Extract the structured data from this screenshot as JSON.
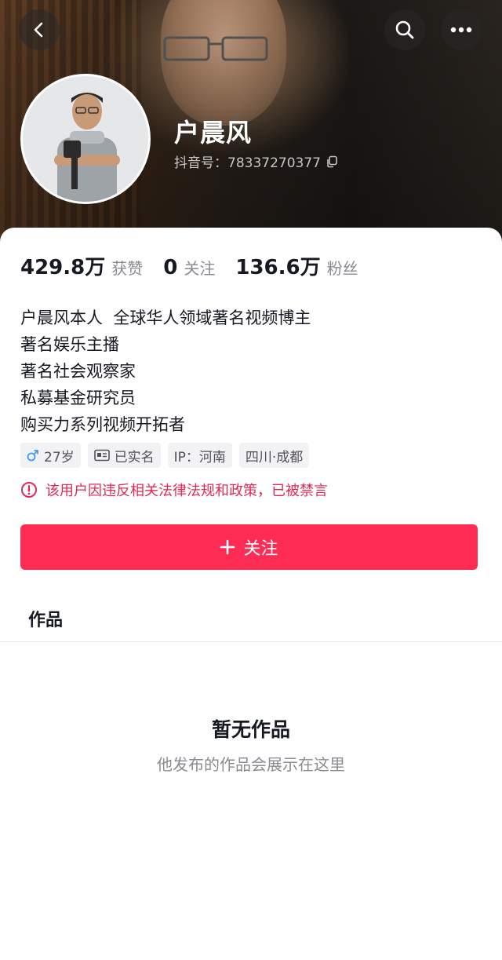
{
  "header": {
    "username": "户晨风",
    "douyin_id": "抖音号：78337270377"
  },
  "stats": [
    {
      "value": "429.8万",
      "label": "获赞"
    },
    {
      "value": "0",
      "label": "关注"
    },
    {
      "value": "136.6万",
      "label": "粉丝"
    }
  ],
  "bio": [
    "户晨风本人  全球华人领域著名视频博主",
    "著名娱乐主播",
    "著名社会观察家",
    "私募基金研究员",
    "购买力系列视频开拓者"
  ],
  "tags": {
    "age": "27岁",
    "verified": "已实名",
    "ip": "IP：河南",
    "location": "四川·成都"
  },
  "warning": "该用户因违反相关法律法规和政策，已被禁言",
  "follow_button": "关注",
  "tab_works": "作品",
  "empty": {
    "title": "暂无作品",
    "subtitle": "他发布的作品会展示在这里"
  },
  "colors": {
    "accent": "#fe2c55",
    "warning": "#e02a55",
    "secondary_text": "#8a8b91",
    "male_icon": "#3d9cf0"
  },
  "icons": [
    "back-icon",
    "search-icon",
    "more-icon",
    "copy-icon",
    "male-icon",
    "id-card-icon",
    "warning-icon",
    "plus-icon"
  ]
}
